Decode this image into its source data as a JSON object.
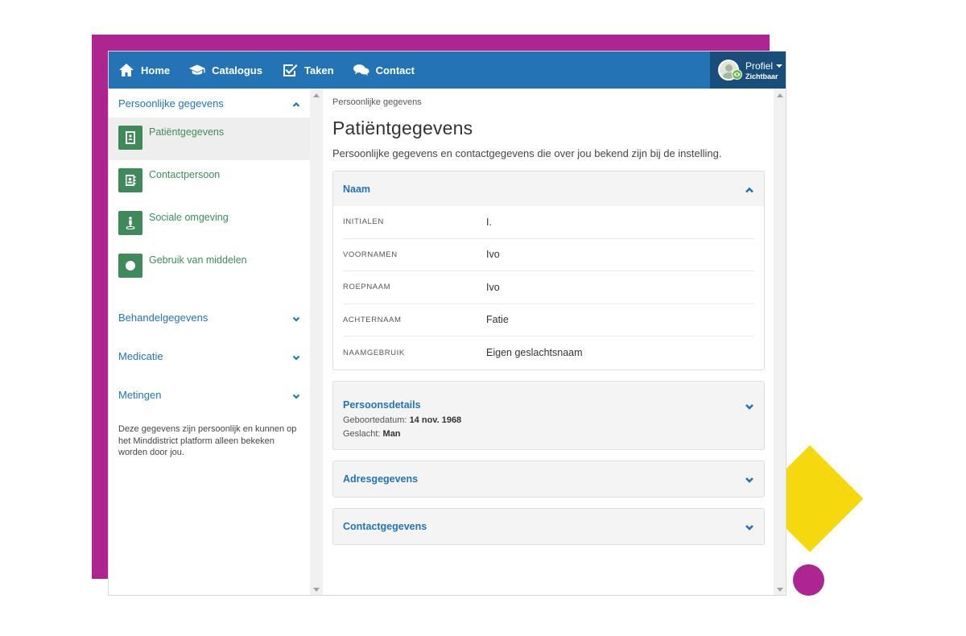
{
  "colors": {
    "brand_blue": "#2473b4",
    "brand_dark_blue": "#1a4e7a",
    "accent_green": "#3f8a5b",
    "deco_purple": "#ad2590",
    "deco_yellow": "#f5d90e"
  },
  "topbar": {
    "items": [
      {
        "label": "Home",
        "icon": "home-icon"
      },
      {
        "label": "Catalogus",
        "icon": "graduation-cap-icon"
      },
      {
        "label": "Taken",
        "icon": "checkbox-icon"
      },
      {
        "label": "Contact",
        "icon": "chat-bubbles-icon"
      }
    ],
    "profile": {
      "name": "Profiel",
      "status": "Zichtbaar"
    }
  },
  "sidebar": {
    "sections": [
      {
        "label": "Persoonlijke gegevens",
        "expanded": true
      },
      {
        "label": "Behandelgegevens",
        "expanded": false
      },
      {
        "label": "Medicatie",
        "expanded": false
      },
      {
        "label": "Metingen",
        "expanded": false
      }
    ],
    "items": [
      {
        "label": "Patiëntgegevens",
        "icon": "id-card-icon",
        "active": true
      },
      {
        "label": "Contactpersoon",
        "icon": "contact-book-icon",
        "active": false
      },
      {
        "label": "Sociale omgeving",
        "icon": "person-pin-icon",
        "active": false
      },
      {
        "label": "Gebruik van middelen",
        "icon": "circle-icon",
        "active": false
      }
    ],
    "note": "Deze gegevens zijn persoonlijk en kunnen op het Minddistrict platform alleen bekeken worden door jou."
  },
  "main": {
    "breadcrumb": "Persoonlijke gegevens",
    "title": "Patiëntgegevens",
    "description": "Persoonlijke gegevens en contactgegevens die over jou bekend zijn bij de instelling.",
    "naam": {
      "title": "Naam",
      "rows": [
        {
          "label": "INITIALEN",
          "value": "I."
        },
        {
          "label": "VOORNAMEN",
          "value": "Ivo"
        },
        {
          "label": "ROEPNAAM",
          "value": "Ivo"
        },
        {
          "label": "ACHTERNAAM",
          "value": "Fatie"
        },
        {
          "label": "NAAMGEBRUIK",
          "value": "Eigen geslachtsnaam"
        }
      ]
    },
    "persoonsdetails": {
      "title": "Persoonsdetails",
      "birth_label": "Geboortedatum:",
      "birth_value": "14 nov. 1968",
      "gender_label": "Geslacht:",
      "gender_value": "Man"
    },
    "adres": {
      "title": "Adresgegevens"
    },
    "contact": {
      "title": "Contactgegevens"
    }
  }
}
